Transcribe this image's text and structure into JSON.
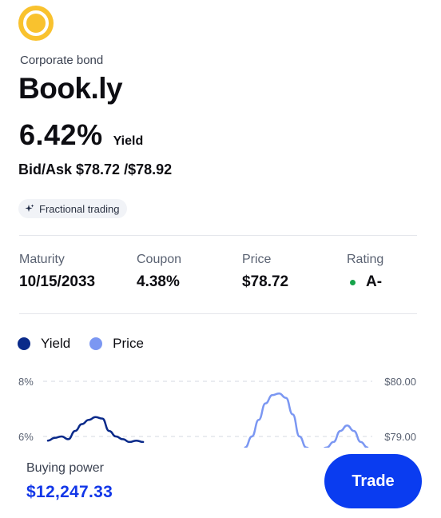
{
  "bond": {
    "type_label": "Corporate bond",
    "name": "Book.ly",
    "yield_value": "6.42%",
    "yield_label": "Yield",
    "bid_ask": "Bid/Ask $78.72 /$78.92",
    "chip_label": "Fractional trading"
  },
  "stats": [
    {
      "label": "Maturity",
      "value": "10/15/2033"
    },
    {
      "label": "Coupon",
      "value": "4.38%"
    },
    {
      "label": "Price",
      "value": "$78.72"
    },
    {
      "label": "Rating",
      "value": "A-"
    }
  ],
  "colors": {
    "logo": "#f9c22e",
    "yield_series": "#0a2a8a",
    "price_series": "#7b97f2",
    "accent": "#0a3cf0",
    "rating_dot": "#16a34a"
  },
  "chart_data": {
    "type": "line",
    "series": [
      {
        "name": "Yield",
        "axis": "left",
        "x": [
          1,
          2,
          3,
          4,
          5,
          6,
          7,
          8,
          9,
          10,
          11,
          12,
          13,
          14,
          15
        ],
        "values": [
          5.85,
          5.95,
          6.0,
          5.9,
          6.2,
          6.45,
          6.6,
          6.7,
          6.65,
          6.2,
          6.0,
          5.9,
          5.8,
          5.85,
          5.8
        ]
      },
      {
        "name": "Price",
        "axis": "right",
        "x": [
          30,
          31,
          32,
          33,
          34,
          35,
          36,
          37,
          38,
          39,
          40,
          41,
          42,
          43,
          44,
          45,
          46,
          47,
          48
        ],
        "values": [
          78.8,
          79.0,
          79.3,
          79.6,
          79.75,
          79.78,
          79.7,
          79.4,
          79.0,
          78.8,
          78.7,
          78.75,
          78.8,
          78.9,
          79.1,
          79.2,
          79.1,
          78.9,
          78.8
        ]
      }
    ],
    "left_axis": {
      "ticks": [
        "8%",
        "6%"
      ],
      "ylim": [
        6,
        8
      ]
    },
    "right_axis": {
      "ticks": [
        "$80.00",
        "$79.00"
      ],
      "ylim": [
        79,
        80
      ]
    },
    "legend": [
      "Yield",
      "Price"
    ],
    "legend_position": "top-left",
    "grid": "dashed horizontal"
  },
  "footer": {
    "buying_power_label": "Buying power",
    "buying_power_value": "$12,247.33",
    "trade_label": "Trade"
  }
}
